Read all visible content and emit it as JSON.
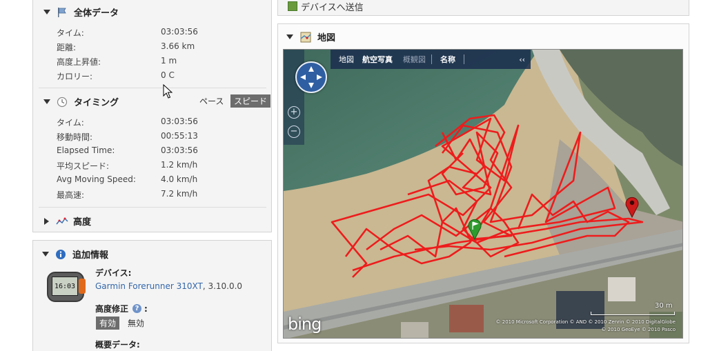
{
  "summary": {
    "title": "全体データ",
    "rows": [
      {
        "label": "タイム:",
        "value": "03:03:56"
      },
      {
        "label": "距離:",
        "value": "3.66 km"
      },
      {
        "label": "高度上昇値:",
        "value": "1 m"
      },
      {
        "label": "カロリー:",
        "value": "0 C"
      }
    ]
  },
  "timing": {
    "title": "タイミング",
    "toggle_pace": "ペース",
    "toggle_speed": "スピード",
    "rows": [
      {
        "label": "タイム:",
        "value": "03:03:56"
      },
      {
        "label": "移動時間:",
        "value": "00:55:13"
      },
      {
        "label": "Elapsed Time:",
        "value": "03:03:56"
      },
      {
        "label": "平均スピード:",
        "value": "1.2 km/h"
      },
      {
        "label": "Avg Moving Speed:",
        "value": "4.0 km/h"
      },
      {
        "label": "最高速:",
        "value": "7.2 km/h"
      }
    ]
  },
  "elevation": {
    "title": "高度"
  },
  "extra": {
    "title": "追加情報",
    "device_label": "デバイス:",
    "device_name": "Garmin Forerunner 310XT",
    "device_version": ", 3.10.0.0",
    "elev_correction_label": "高度修正",
    "elev_colon": ":",
    "enabled": "有効",
    "disabled": "無効",
    "summary_data_label": "概要データ:",
    "watch_display": "16:03"
  },
  "send_to_device": {
    "label": "デバイスへ送信"
  },
  "map": {
    "title": "地図",
    "tabs": [
      "地図",
      "航空写真",
      "概観図",
      "名称"
    ],
    "collapse": "‹‹",
    "zoom_in": "+",
    "zoom_out": "−",
    "brand": "bing",
    "scale_label": "30 m",
    "copyright_line1": "© 2010 Microsoft Corporation  © AND  © 2010 Zenrin  © 2010 DigitalGlobe",
    "copyright_line2": "© 2010 GeoEye  © 2010 Pasco"
  },
  "colors": {
    "track": "#ee1c1c",
    "link": "#3366aa",
    "start_pin": "#2e9b2e",
    "end_pin": "#cc1a1a"
  }
}
